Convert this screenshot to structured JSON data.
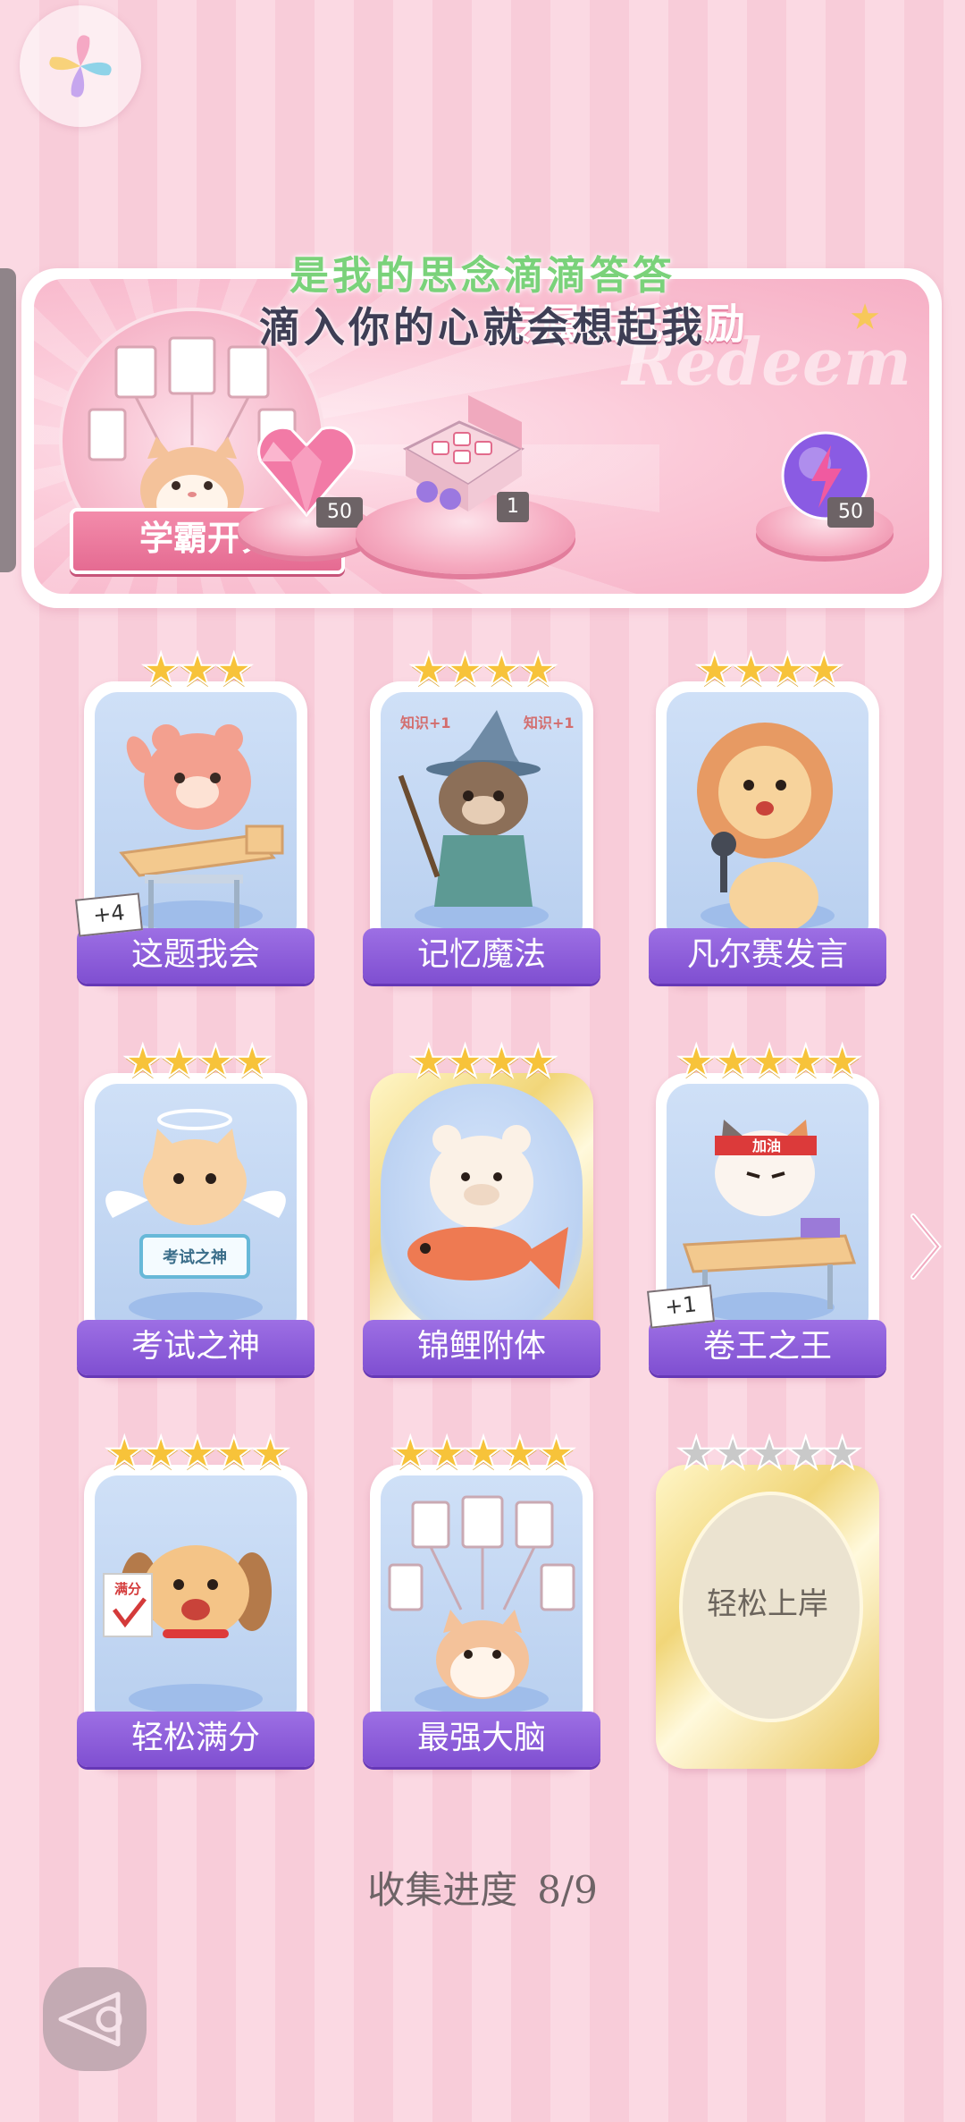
{
  "overlay": {
    "line1": "是我的思念滴滴答答",
    "line2": "滴入你的心就会想起我"
  },
  "banner": {
    "title": "专属贴纸奖励",
    "watermark": "Redeem",
    "badge_label": "学霸开秀",
    "rewards": [
      {
        "icon": "pink-heart-gem-icon",
        "qty": "50"
      },
      {
        "icon": "gift-box-icon",
        "qty": "1"
      },
      {
        "icon": "purple-energy-orb-icon",
        "qty": "50"
      }
    ]
  },
  "cards": [
    {
      "label": "这题我会",
      "stars": 3,
      "max_stars": 3,
      "bonus": "+4",
      "icon": "bear-at-desk-icon"
    },
    {
      "label": "记忆魔法",
      "stars": 4,
      "max_stars": 4,
      "icon": "wizard-otter-icon",
      "caption": "知识+1"
    },
    {
      "label": "凡尔赛发言",
      "stars": 4,
      "max_stars": 4,
      "icon": "lion-microphone-icon"
    },
    {
      "label": "考试之神",
      "stars": 4,
      "max_stars": 4,
      "icon": "angel-cat-icon",
      "sign": "考试之神"
    },
    {
      "label": "锦鲤附体",
      "stars": 4,
      "max_stars": 4,
      "icon": "bear-koi-icon",
      "gold": true
    },
    {
      "label": "卷王之王",
      "stars": 5,
      "max_stars": 5,
      "bonus": "+1",
      "icon": "cat-studying-icon",
      "headband": "加油"
    },
    {
      "label": "轻松满分",
      "stars": 5,
      "max_stars": 5,
      "icon": "puppy-full-score-icon",
      "paper": "满分"
    },
    {
      "label": "最强大脑",
      "stars": 5,
      "max_stars": 5,
      "icon": "cat-documents-icon"
    },
    {
      "label": "轻松上岸",
      "stars": 0,
      "max_stars": 5,
      "locked": true
    }
  ],
  "progress": {
    "label": "收集进度",
    "value": "8/9"
  },
  "colors": {
    "accent": "#8a5ad8",
    "background": "#fbd9e3",
    "star": "#f7c33a"
  }
}
